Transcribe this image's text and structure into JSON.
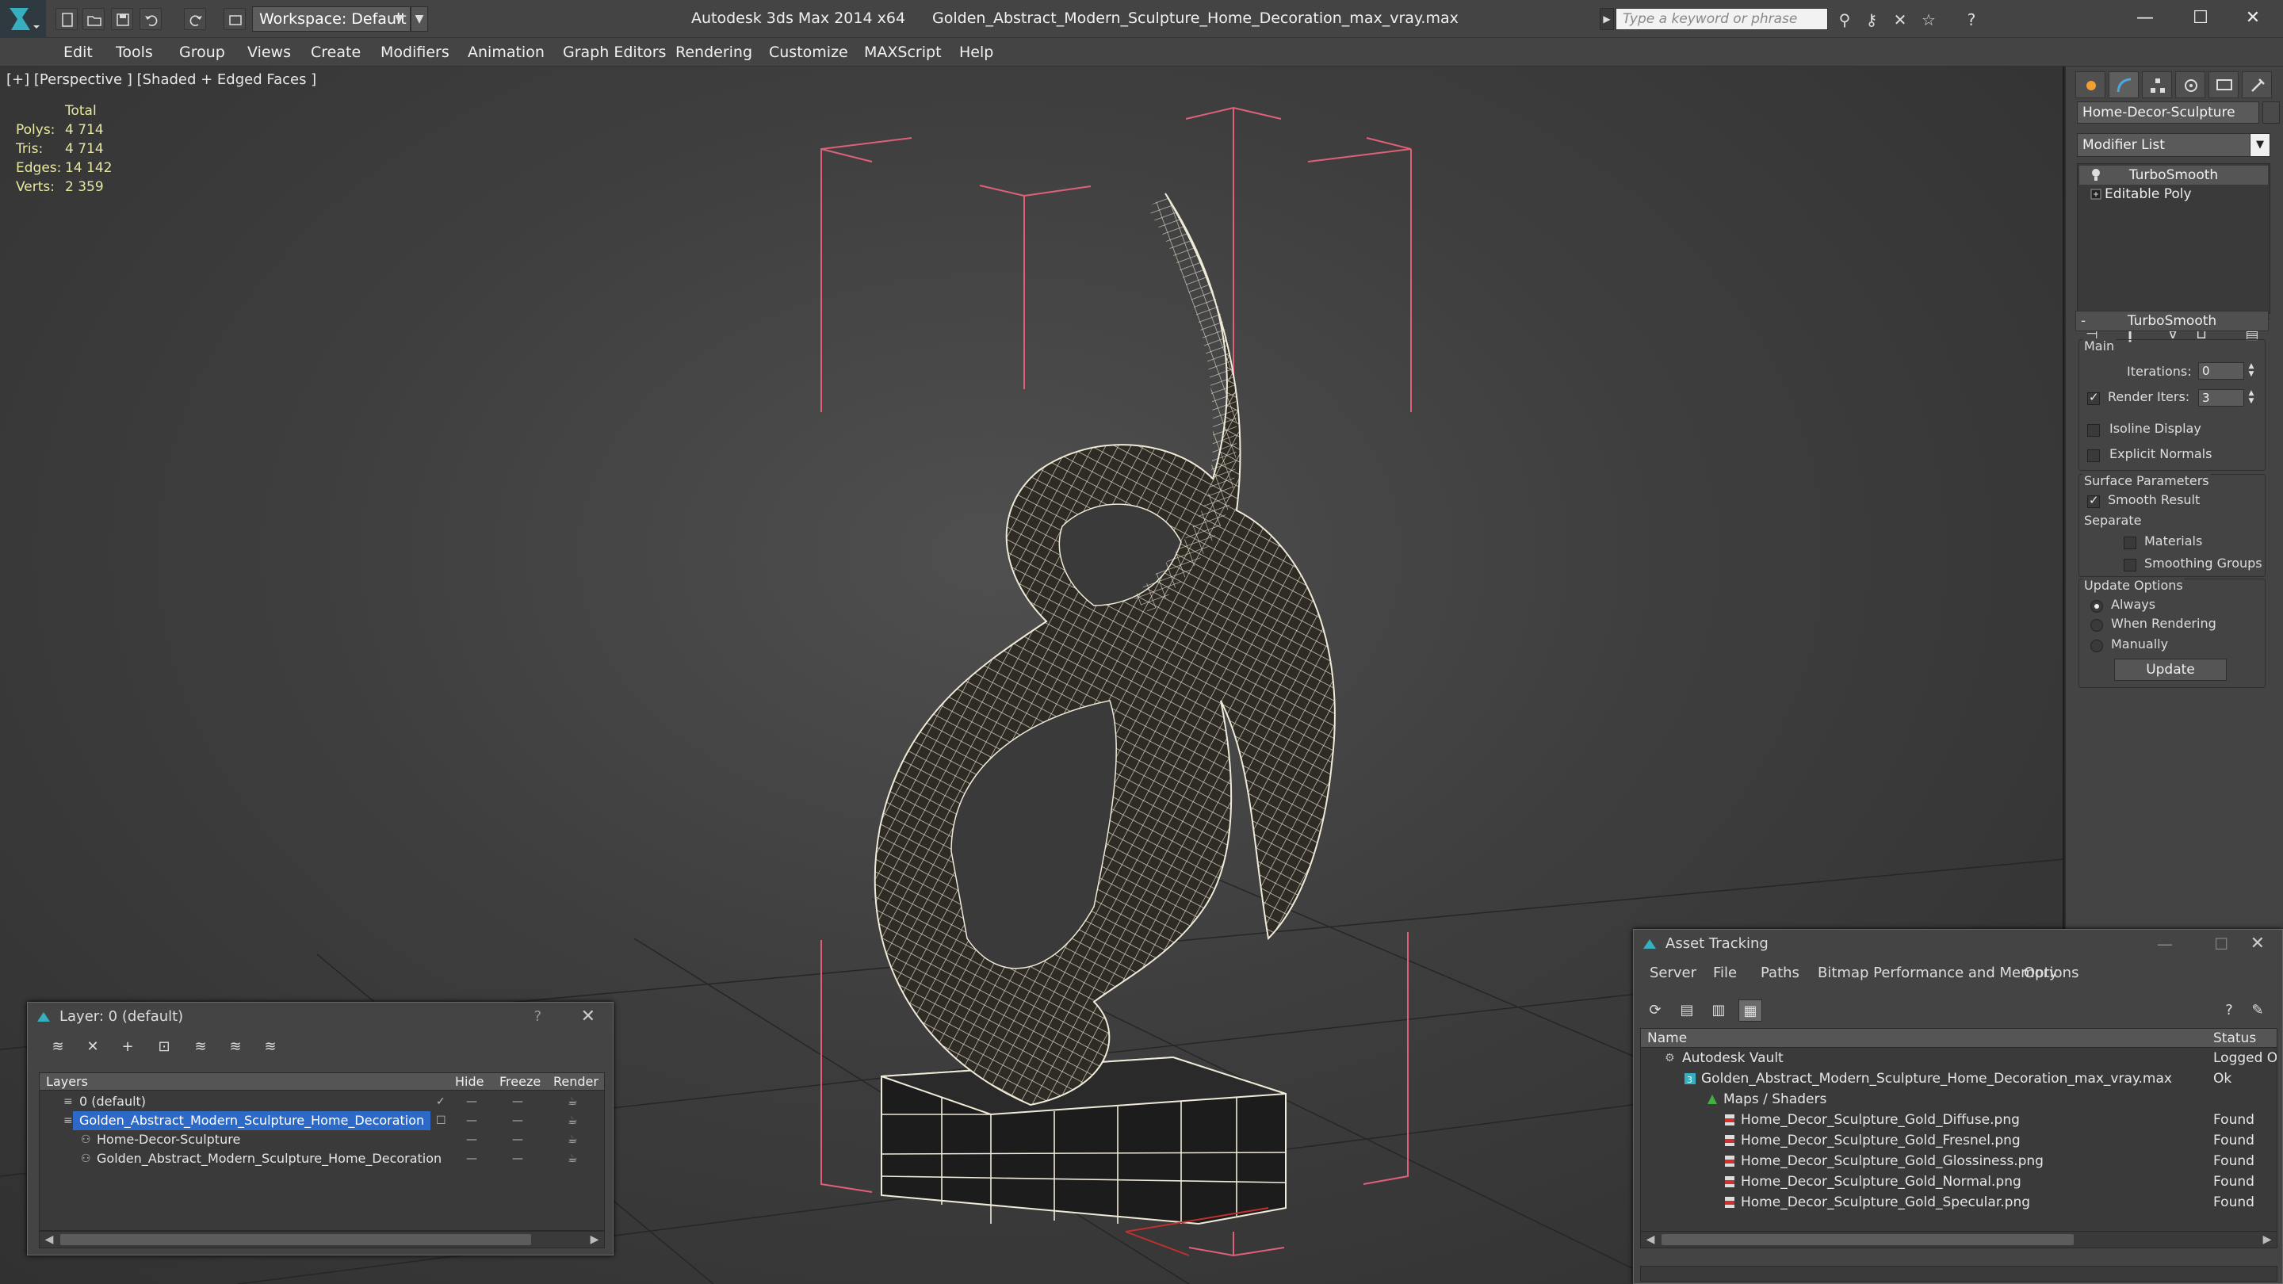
{
  "window": {
    "app_title": "Autodesk 3ds Max  2014 x64",
    "file_title": "Golden_Abstract_Modern_Sculpture_Home_Decoration_max_vray.max",
    "workspace_label": "Workspace: Default",
    "search_placeholder": "Type a keyword or phrase",
    "minimize": "—",
    "maximize": "☐",
    "close": "✕"
  },
  "menu": [
    "Edit",
    "Tools",
    "Group",
    "Views",
    "Create",
    "Modifiers",
    "Animation",
    "Graph Editors",
    "Rendering",
    "Customize",
    "MAXScript",
    "Help"
  ],
  "viewport": {
    "label": "[+] [Perspective ] [Shaded + Edged Faces ]",
    "stats": {
      "total_label": "Total",
      "rows": [
        {
          "key": "Polys:",
          "value": "4 714"
        },
        {
          "key": "Tris:",
          "value": "4 714"
        },
        {
          "key": "Edges:",
          "value": "14 142"
        },
        {
          "key": "Verts:",
          "value": "2 359"
        }
      ]
    }
  },
  "command_panel": {
    "object_name": "Home-Decor-Sculpture",
    "modifier_list": "Modifier List",
    "stack": [
      "TurboSmooth",
      "Editable Poly"
    ],
    "rollout_title": "TurboSmooth",
    "main_group": "Main",
    "iterations_label": "Iterations:",
    "iterations_value": "0",
    "render_iters_label": "Render Iters:",
    "render_iters_value": "3",
    "isoline_label": "Isoline Display",
    "explicit_normals_label": "Explicit Normals",
    "surface_group": "Surface Parameters",
    "smooth_result_label": "Smooth Result",
    "separate_label": "Separate",
    "materials_label": "Materials",
    "smoothing_groups_label": "Smoothing Groups",
    "update_group": "Update Options",
    "always_label": "Always",
    "when_rendering_label": "When Rendering",
    "manually_label": "Manually",
    "update_button": "Update"
  },
  "layer_dialog": {
    "title": "Layer: 0 (default)",
    "help": "?",
    "close": "✕",
    "columns": [
      "Layers",
      "Hide",
      "Freeze",
      "Render"
    ],
    "rows": [
      {
        "name": "0 (default)",
        "indent": 1
      },
      {
        "name": "Golden_Abstract_Modern_Sculpture_Home_Decoration",
        "indent": 1,
        "selected": true
      },
      {
        "name": "Home-Decor-Sculpture",
        "indent": 2
      },
      {
        "name": "Golden_Abstract_Modern_Sculpture_Home_Decoration",
        "indent": 2
      }
    ]
  },
  "asset_tracking": {
    "title": "Asset Tracking",
    "menu": [
      "Server",
      "File",
      "Paths",
      "Bitmap Performance and Memory",
      "Options"
    ],
    "columns": [
      "Name",
      "Status"
    ],
    "rows": [
      {
        "name": "Autodesk Vault",
        "status": "Logged O",
        "indent": 0
      },
      {
        "name": "Golden_Abstract_Modern_Sculpture_Home_Decoration_max_vray.max",
        "status": "Ok",
        "indent": 1
      },
      {
        "name": "Maps / Shaders",
        "status": "",
        "indent": 2
      },
      {
        "name": "Home_Decor_Sculpture_Gold_Diffuse.png",
        "status": "Found",
        "indent": 3
      },
      {
        "name": "Home_Decor_Sculpture_Gold_Fresnel.png",
        "status": "Found",
        "indent": 3
      },
      {
        "name": "Home_Decor_Sculpture_Gold_Glossiness.png",
        "status": "Found",
        "indent": 3
      },
      {
        "name": "Home_Decor_Sculpture_Gold_Normal.png",
        "status": "Found",
        "indent": 3
      },
      {
        "name": "Home_Decor_Sculpture_Gold_Specular.png",
        "status": "Found",
        "indent": 3
      }
    ]
  },
  "colors": {
    "selection_blue": "#2d6ac8",
    "bbox_pink": "#e0607a",
    "wire": "#f0ead8",
    "stats_yellow": "#e8e8a0"
  }
}
